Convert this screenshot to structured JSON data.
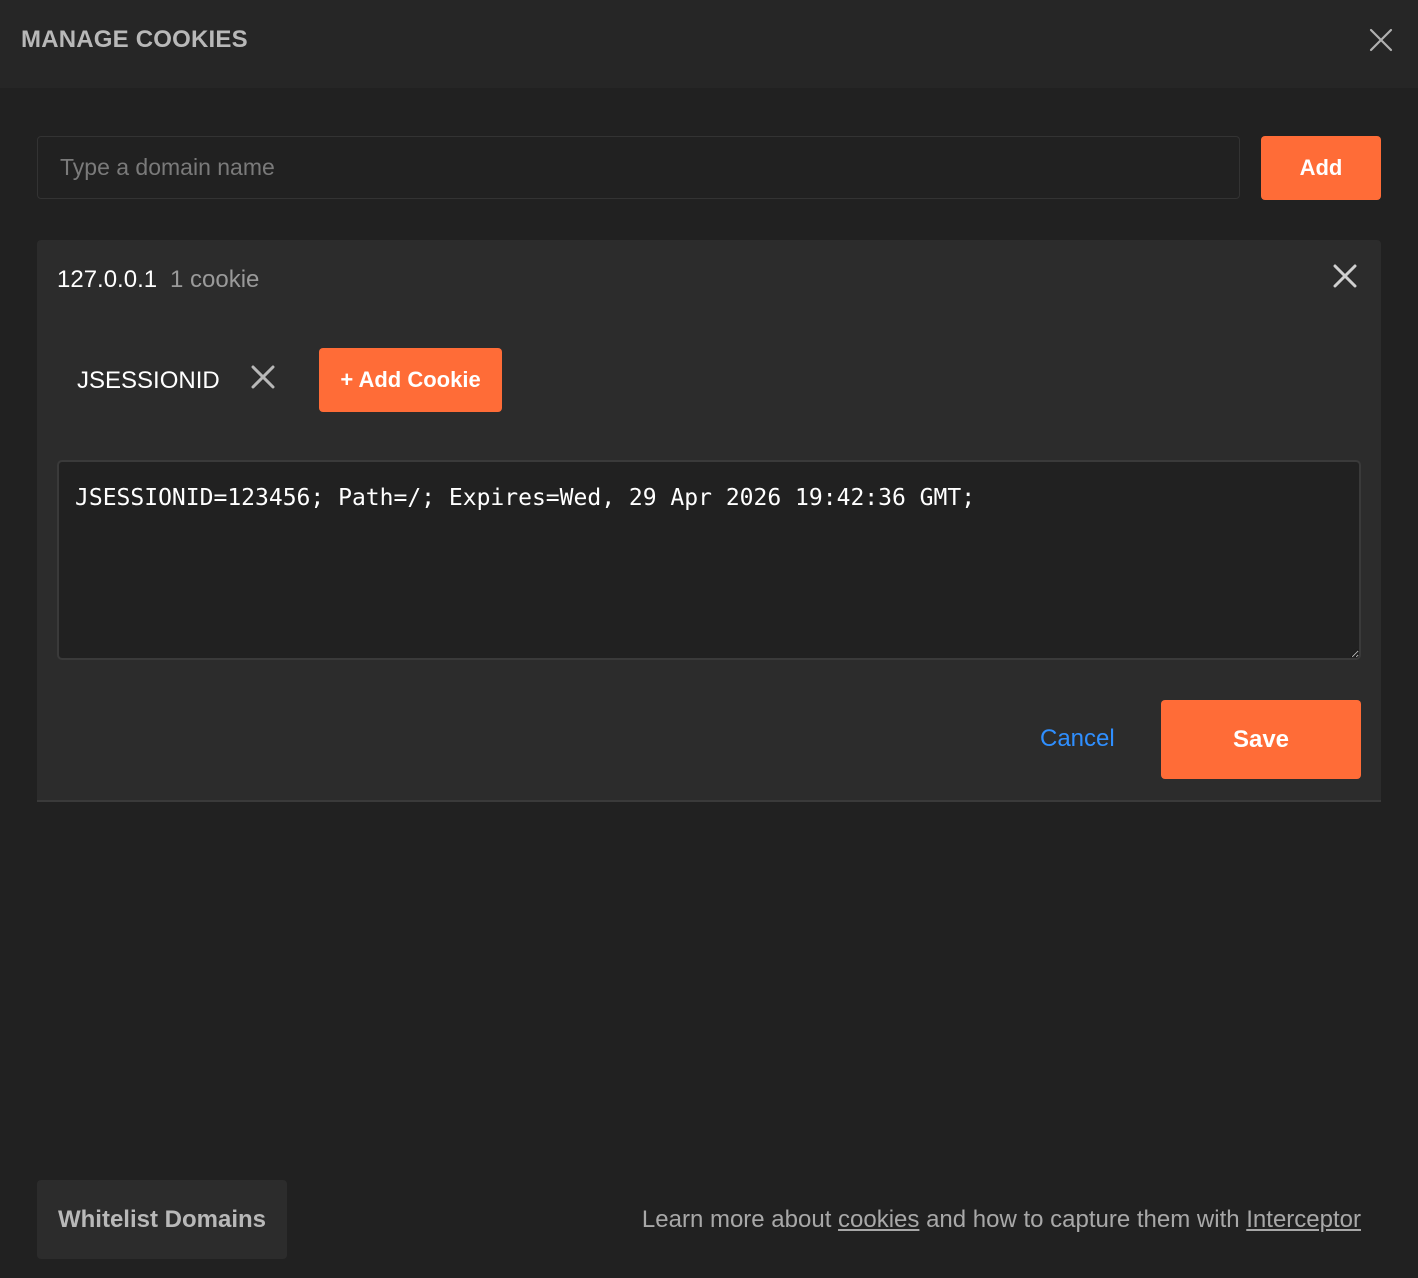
{
  "header": {
    "title": "MANAGE COOKIES",
    "close_icon": "close-icon"
  },
  "domain_form": {
    "placeholder": "Type a domain name",
    "value": "",
    "add_label": "Add"
  },
  "domains": [
    {
      "name": "127.0.0.1",
      "count_label": "1 cookie",
      "remove_icon": "close-icon",
      "cookies": [
        {
          "name": "JSESSIONID",
          "remove_icon": "close-icon"
        }
      ],
      "add_cookie_label": "+ Add Cookie",
      "editor_value": "JSESSIONID=123456; Path=/; Expires=Wed, 29 Apr 2026 19:42:36 GMT;",
      "cancel_label": "Cancel",
      "save_label": "Save"
    }
  ],
  "footer": {
    "whitelist_label": "Whitelist Domains",
    "learn_prefix": "Learn more about ",
    "cookies_link": "cookies",
    "learn_middle": " and how to capture them with ",
    "interceptor_link": "Interceptor"
  },
  "colors": {
    "accent": "#ff6c37",
    "link": "#2f8fff",
    "background": "#212121",
    "panel": "#2c2c2c"
  }
}
